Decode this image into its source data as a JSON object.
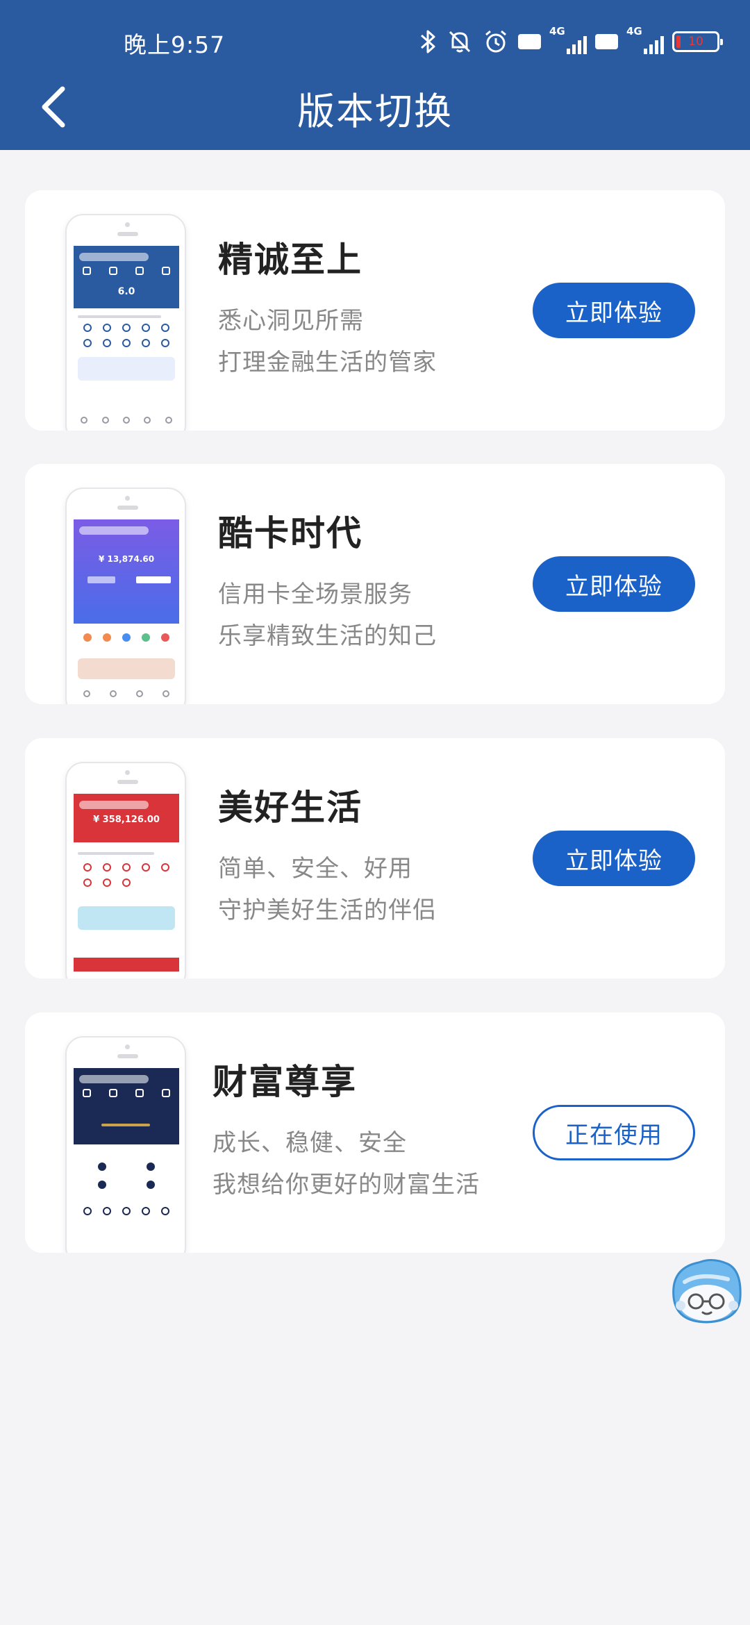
{
  "status_bar": {
    "time": "晚上9:57",
    "hd1": "HD",
    "net1": "4G",
    "hd2": "HD",
    "net2": "4G",
    "battery": "10",
    "icons": [
      "bluetooth-icon",
      "bell-muted-icon",
      "alarm-icon",
      "signal-icon",
      "battery-icon"
    ]
  },
  "header": {
    "title": "版本切换",
    "back_icon": "chevron-left-icon"
  },
  "versions": [
    {
      "name": "精诚至上",
      "line1": "悉心洞见所需",
      "line2": "打理金融生活的管家",
      "button": "立即体验",
      "button_style": "primary",
      "theme_color": "#2a5aa0",
      "amount": "6.0"
    },
    {
      "name": "酷卡时代",
      "line1": "信用卡全场景服务",
      "line2": "乐享精致生活的知己",
      "button": "立即体验",
      "button_style": "primary",
      "theme_color": "#7b5ce6",
      "amount": "¥ 13,874.60"
    },
    {
      "name": "美好生活",
      "line1": "简单、安全、好用",
      "line2": "守护美好生活的伴侣",
      "button": "立即体验",
      "button_style": "primary",
      "theme_color": "#d9343a",
      "amount": "¥ 358,126.00"
    },
    {
      "name": "财富尊享",
      "line1": "成长、稳健、安全",
      "line2": "我想给你更好的财富生活",
      "button": "正在使用",
      "button_style": "outline",
      "theme_color": "#1a2a55",
      "amount": ""
    }
  ],
  "colors": {
    "header_bg": "#2a5aa0",
    "accent": "#1b62c8",
    "page_bg": "#f4f4f6"
  },
  "mascot_icon": "assistant-mascot-icon"
}
